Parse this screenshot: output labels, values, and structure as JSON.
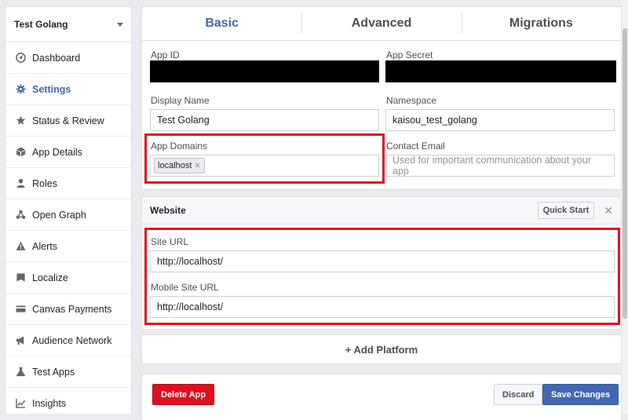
{
  "app_selector": {
    "name": "Test Golang"
  },
  "sidebar": {
    "items": [
      {
        "label": "Dashboard",
        "icon": "dashboard-icon"
      },
      {
        "label": "Settings",
        "icon": "gear-icon",
        "active": true
      },
      {
        "label": "Status & Review",
        "icon": "star-icon"
      },
      {
        "label": "App Details",
        "icon": "cube-icon"
      },
      {
        "label": "Roles",
        "icon": "person-icon"
      },
      {
        "label": "Open Graph",
        "icon": "graph-icon"
      },
      {
        "label": "Alerts",
        "icon": "alert-icon"
      },
      {
        "label": "Localize",
        "icon": "flag-icon"
      },
      {
        "label": "Canvas Payments",
        "icon": "card-icon"
      },
      {
        "label": "Audience Network",
        "icon": "megaphone-icon"
      },
      {
        "label": "Test Apps",
        "icon": "flask-icon"
      },
      {
        "label": "Insights",
        "icon": "chart-icon"
      }
    ]
  },
  "tabs": [
    {
      "label": "Basic",
      "active": true
    },
    {
      "label": "Advanced"
    },
    {
      "label": "Migrations"
    }
  ],
  "basic": {
    "app_id_label": "App ID",
    "app_secret_label": "App Secret",
    "display_name_label": "Display Name",
    "display_name_value": "Test Golang",
    "namespace_label": "Namespace",
    "namespace_value": "kaisou_test_golang",
    "app_domains_label": "App Domains",
    "app_domains_token": "localhost",
    "contact_email_label": "Contact Email",
    "contact_email_placeholder": "Used for important communication about your app"
  },
  "website": {
    "title": "Website",
    "quick_start_label": "Quick Start",
    "site_url_label": "Site URL",
    "site_url_value": "http://localhost/",
    "mobile_site_url_label": "Mobile Site URL",
    "mobile_site_url_value": "http://localhost/"
  },
  "add_platform_label": "+ Add Platform",
  "footer": {
    "delete_label": "Delete App",
    "discard_label": "Discard",
    "save_label": "Save Changes"
  },
  "colors": {
    "accent": "#4267b2",
    "highlight": "#e0101f",
    "danger": "#e0101f"
  }
}
